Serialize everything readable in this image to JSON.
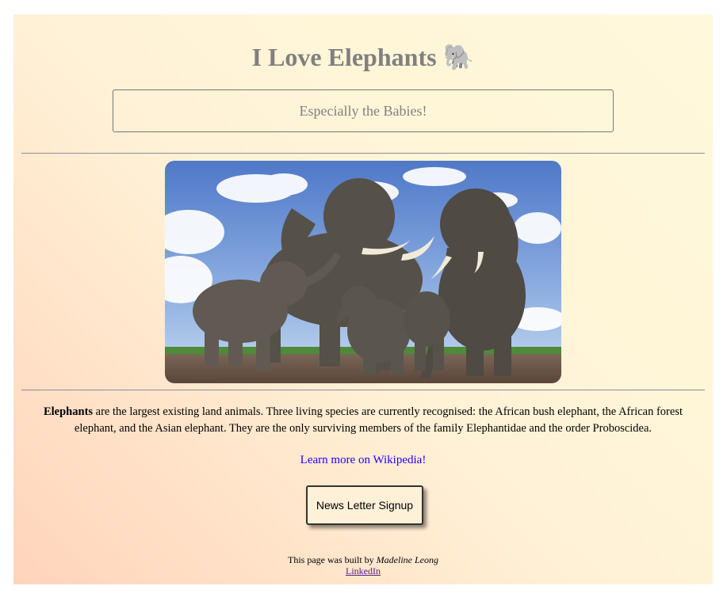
{
  "header": {
    "title": "I Love Elephants",
    "title_emoji": "🐘",
    "subtitle": "Especially the Babies!"
  },
  "main": {
    "image_subject": "herd of elephants with babies under blue sky",
    "description_bold": "Elephants",
    "description_text": " are the largest existing land animals. Three living species are currently recognised: the African bush elephant, the African forest elephant, and the Asian elephant. They are the only surviving members of the family Elephantidae and the order Proboscidea.",
    "wiki_link": "Learn more on Wikipedia!",
    "signup_button": "News Letter Signup"
  },
  "footer": {
    "built_by_prefix": "This page was built by ",
    "author": "Madeline Leong",
    "linkedin": "LinkedIn"
  },
  "colors": {
    "title": "#808080",
    "link": "#1f00ff",
    "visited_link": "#551a8b",
    "gradient_start": "#ffd4bb",
    "gradient_end": "#fff8dc"
  }
}
